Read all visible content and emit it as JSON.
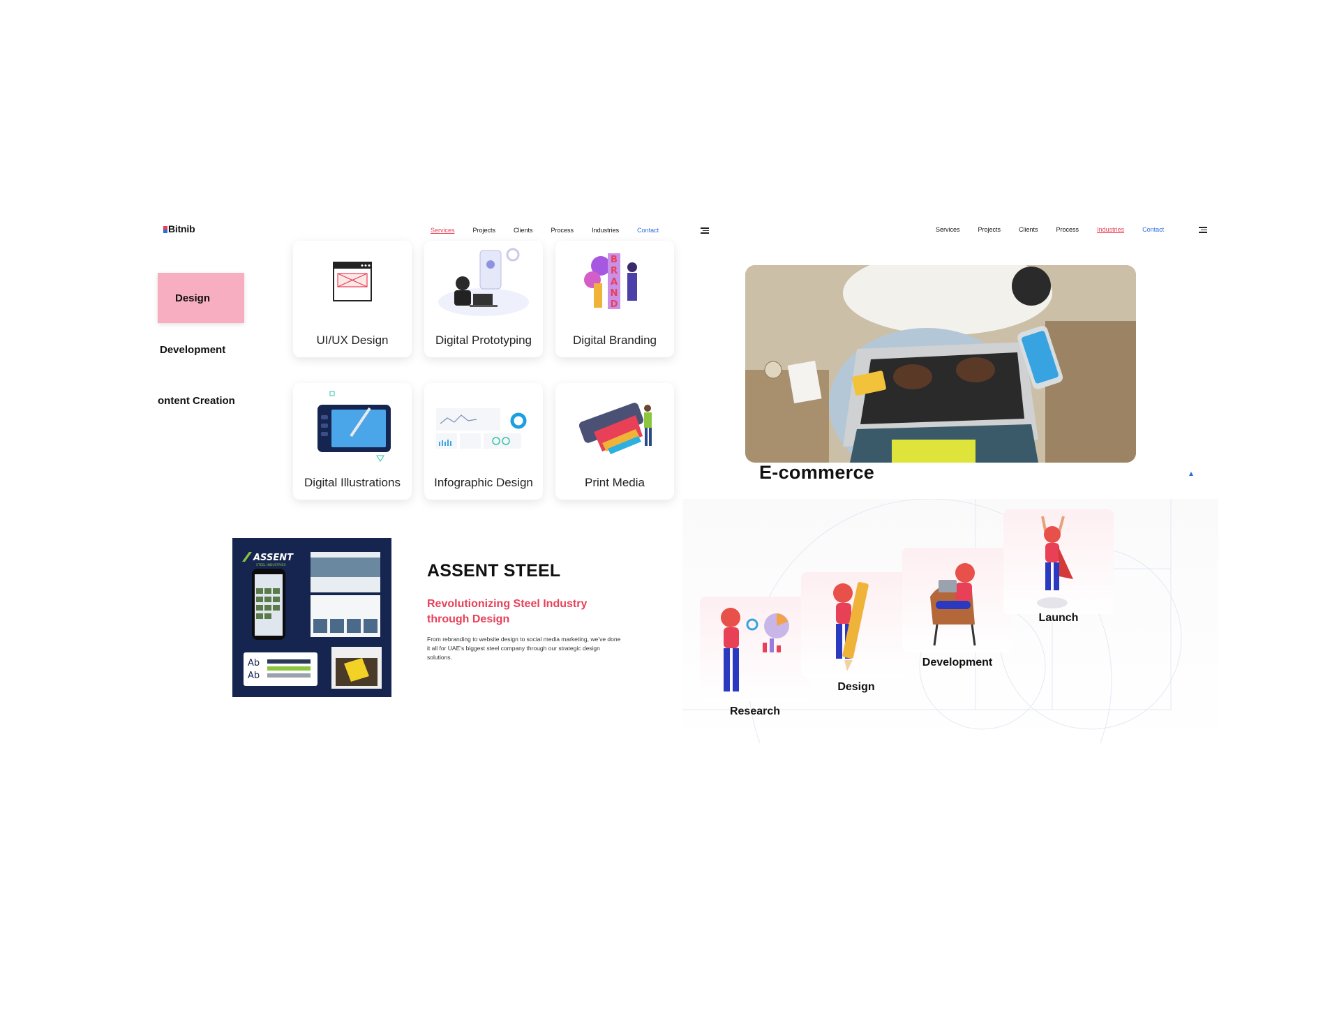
{
  "left": {
    "logo": "Bitnib",
    "nav": [
      "Services",
      "Projects",
      "Clients",
      "Process",
      "Industries",
      "Contact"
    ],
    "tabs": [
      "Design",
      "Development",
      "ontent Creation"
    ],
    "cards": [
      "UI/UX Design",
      "Digital Prototyping",
      "Digital Branding",
      "Digital Illustrations",
      "Infographic Design",
      "Print Media"
    ],
    "project": {
      "title": "ASSENT STEEL",
      "subtitle_line1": "Revolutionizing Steel Industry",
      "subtitle_line2": "through Design",
      "description": "From rebranding to website design to social media marketing, we’ve done it all for UAE’s biggest steel company through our strategic design solutions.",
      "thumb_brand": "ASSENT",
      "thumb_brand_sub": "STEEL INDUSTRIES",
      "thumb_ab1": "Ab",
      "thumb_ab2": "Ab"
    }
  },
  "right": {
    "nav": [
      "Services",
      "Projects",
      "Clients",
      "Process",
      "Industries",
      "Contact"
    ],
    "industry_title": "E-commerce",
    "stages": [
      "Research",
      "Design",
      "Development",
      "Launch"
    ]
  },
  "colors": {
    "accent_red": "#e84057",
    "accent_blue": "#2c6de0",
    "pink_tab": "#f7aec0",
    "navy": "#15254f"
  }
}
